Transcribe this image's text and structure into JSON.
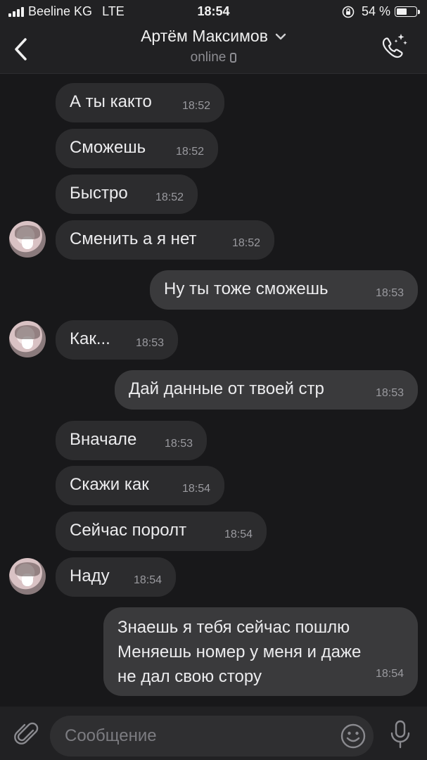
{
  "status_bar": {
    "carrier": "Beeline KG",
    "network": "LTE",
    "time": "18:54",
    "battery": "54 %",
    "battery_level": 0.54
  },
  "header": {
    "contact_name": "Артём Максимов",
    "status": "online"
  },
  "messages": [
    {
      "text": "А ты както",
      "time": "18:52",
      "direction": "in"
    },
    {
      "text": "Сможешь",
      "time": "18:52",
      "direction": "in"
    },
    {
      "text": "Быстро",
      "time": "18:52",
      "direction": "in"
    },
    {
      "text": "Сменить а я нет",
      "time": "18:52",
      "direction": "in",
      "avatar": true
    },
    {
      "text": "Ну ты тоже сможешь",
      "time": "18:53",
      "direction": "out"
    },
    {
      "text": "Как...",
      "time": "18:53",
      "direction": "in",
      "avatar": true
    },
    {
      "text": "Дай данные от твоей стр",
      "time": "18:53",
      "direction": "out"
    },
    {
      "text": "Вначале",
      "time": "18:53",
      "direction": "in"
    },
    {
      "text": "Скажи как",
      "time": "18:54",
      "direction": "in"
    },
    {
      "text": "Сейчас поролт",
      "time": "18:54",
      "direction": "in"
    },
    {
      "text": "Наду",
      "time": "18:54",
      "direction": "in",
      "avatar": true
    },
    {
      "lines": [
        "Знаешь я тебя сейчас пошлю",
        "Меняешь номер у меня и даже",
        "не дал свою стору"
      ],
      "time": "18:54",
      "direction": "out"
    }
  ],
  "composer": {
    "placeholder": "Сообщение"
  },
  "icons": {
    "back": "chevron-left-icon",
    "chevron": "chevron-down-icon",
    "call": "phone-sparkle-icon",
    "attach": "paperclip-icon",
    "emoji": "smiley-icon",
    "mic": "microphone-icon"
  }
}
